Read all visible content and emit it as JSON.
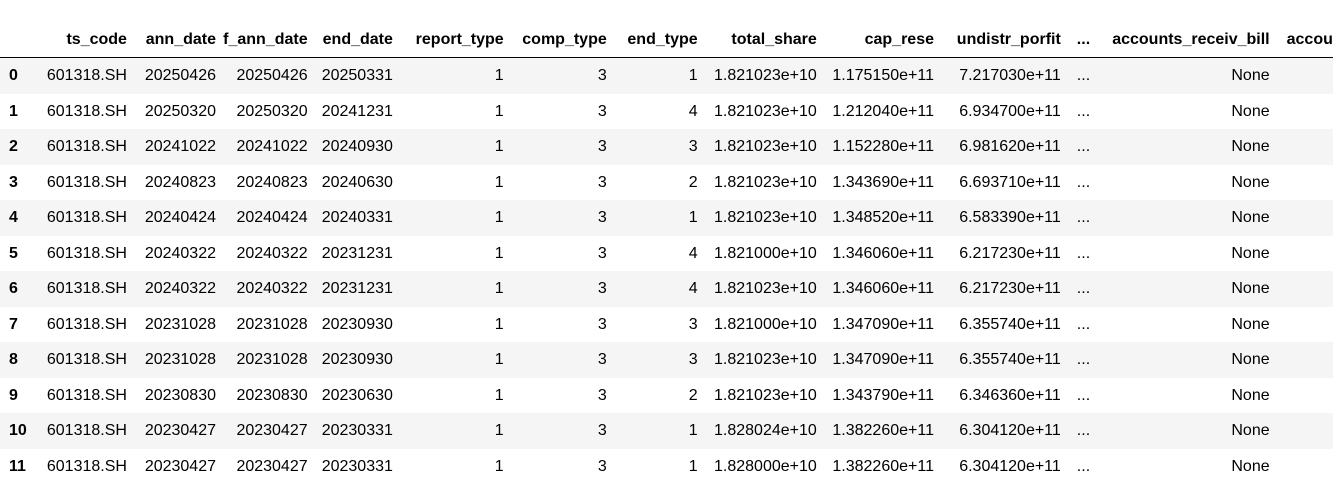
{
  "columns": {
    "index": "",
    "ts_code": "ts_code",
    "ann_date": "ann_date",
    "f_ann_date": "f_ann_date",
    "end_date": "end_date",
    "report_type": "report_type",
    "comp_type": "comp_type",
    "end_type": "end_type",
    "total_share": "total_share",
    "cap_rese": "cap_rese",
    "undistr_porfit": "undistr_porfit",
    "ellipsis": "...",
    "accounts_receiv_bill": "accounts_receiv_bill",
    "truncated": "accou"
  },
  "rows": [
    {
      "idx": "0",
      "ts_code": "601318.SH",
      "ann_date": "20250426",
      "f_ann_date": "20250426",
      "end_date": "20250331",
      "report_type": "1",
      "comp_type": "3",
      "end_type": "1",
      "total_share": "1.821023e+10",
      "cap_rese": "1.175150e+11",
      "undistr_porfit": "7.217030e+11",
      "ellipsis": "...",
      "accounts_receiv_bill": "None"
    },
    {
      "idx": "1",
      "ts_code": "601318.SH",
      "ann_date": "20250320",
      "f_ann_date": "20250320",
      "end_date": "20241231",
      "report_type": "1",
      "comp_type": "3",
      "end_type": "4",
      "total_share": "1.821023e+10",
      "cap_rese": "1.212040e+11",
      "undistr_porfit": "6.934700e+11",
      "ellipsis": "...",
      "accounts_receiv_bill": "None"
    },
    {
      "idx": "2",
      "ts_code": "601318.SH",
      "ann_date": "20241022",
      "f_ann_date": "20241022",
      "end_date": "20240930",
      "report_type": "1",
      "comp_type": "3",
      "end_type": "3",
      "total_share": "1.821023e+10",
      "cap_rese": "1.152280e+11",
      "undistr_porfit": "6.981620e+11",
      "ellipsis": "...",
      "accounts_receiv_bill": "None"
    },
    {
      "idx": "3",
      "ts_code": "601318.SH",
      "ann_date": "20240823",
      "f_ann_date": "20240823",
      "end_date": "20240630",
      "report_type": "1",
      "comp_type": "3",
      "end_type": "2",
      "total_share": "1.821023e+10",
      "cap_rese": "1.343690e+11",
      "undistr_porfit": "6.693710e+11",
      "ellipsis": "...",
      "accounts_receiv_bill": "None"
    },
    {
      "idx": "4",
      "ts_code": "601318.SH",
      "ann_date": "20240424",
      "f_ann_date": "20240424",
      "end_date": "20240331",
      "report_type": "1",
      "comp_type": "3",
      "end_type": "1",
      "total_share": "1.821023e+10",
      "cap_rese": "1.348520e+11",
      "undistr_porfit": "6.583390e+11",
      "ellipsis": "...",
      "accounts_receiv_bill": "None"
    },
    {
      "idx": "5",
      "ts_code": "601318.SH",
      "ann_date": "20240322",
      "f_ann_date": "20240322",
      "end_date": "20231231",
      "report_type": "1",
      "comp_type": "3",
      "end_type": "4",
      "total_share": "1.821000e+10",
      "cap_rese": "1.346060e+11",
      "undistr_porfit": "6.217230e+11",
      "ellipsis": "...",
      "accounts_receiv_bill": "None"
    },
    {
      "idx": "6",
      "ts_code": "601318.SH",
      "ann_date": "20240322",
      "f_ann_date": "20240322",
      "end_date": "20231231",
      "report_type": "1",
      "comp_type": "3",
      "end_type": "4",
      "total_share": "1.821023e+10",
      "cap_rese": "1.346060e+11",
      "undistr_porfit": "6.217230e+11",
      "ellipsis": "...",
      "accounts_receiv_bill": "None"
    },
    {
      "idx": "7",
      "ts_code": "601318.SH",
      "ann_date": "20231028",
      "f_ann_date": "20231028",
      "end_date": "20230930",
      "report_type": "1",
      "comp_type": "3",
      "end_type": "3",
      "total_share": "1.821000e+10",
      "cap_rese": "1.347090e+11",
      "undistr_porfit": "6.355740e+11",
      "ellipsis": "...",
      "accounts_receiv_bill": "None"
    },
    {
      "idx": "8",
      "ts_code": "601318.SH",
      "ann_date": "20231028",
      "f_ann_date": "20231028",
      "end_date": "20230930",
      "report_type": "1",
      "comp_type": "3",
      "end_type": "3",
      "total_share": "1.821023e+10",
      "cap_rese": "1.347090e+11",
      "undistr_porfit": "6.355740e+11",
      "ellipsis": "...",
      "accounts_receiv_bill": "None"
    },
    {
      "idx": "9",
      "ts_code": "601318.SH",
      "ann_date": "20230830",
      "f_ann_date": "20230830",
      "end_date": "20230630",
      "report_type": "1",
      "comp_type": "3",
      "end_type": "2",
      "total_share": "1.821023e+10",
      "cap_rese": "1.343790e+11",
      "undistr_porfit": "6.346360e+11",
      "ellipsis": "...",
      "accounts_receiv_bill": "None"
    },
    {
      "idx": "10",
      "ts_code": "601318.SH",
      "ann_date": "20230427",
      "f_ann_date": "20230427",
      "end_date": "20230331",
      "report_type": "1",
      "comp_type": "3",
      "end_type": "1",
      "total_share": "1.828024e+10",
      "cap_rese": "1.382260e+11",
      "undistr_porfit": "6.304120e+11",
      "ellipsis": "...",
      "accounts_receiv_bill": "None"
    },
    {
      "idx": "11",
      "ts_code": "601318.SH",
      "ann_date": "20230427",
      "f_ann_date": "20230427",
      "end_date": "20230331",
      "report_type": "1",
      "comp_type": "3",
      "end_type": "1",
      "total_share": "1.828000e+10",
      "cap_rese": "1.382260e+11",
      "undistr_porfit": "6.304120e+11",
      "ellipsis": "...",
      "accounts_receiv_bill": "None"
    }
  ]
}
